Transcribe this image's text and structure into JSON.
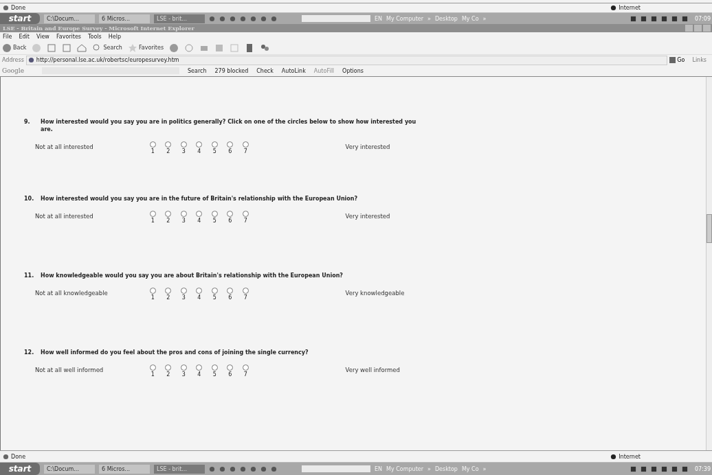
{
  "previous_window": {
    "status": "Done",
    "zone": "Internet"
  },
  "top_taskbar": {
    "start": "start",
    "tasks": [
      {
        "label": "C:\\Docum...",
        "selected": false
      },
      {
        "label": "6 Micros...",
        "selected": false
      },
      {
        "label": "LSE - brit...",
        "selected": true
      }
    ],
    "toolbars": [
      "EN",
      "My Computer",
      "»",
      "Desktop",
      "My Co",
      "»"
    ],
    "clock": "07:09"
  },
  "window": {
    "title": "LSE - Britain and Europe Survey - Microsoft Internet Explorer"
  },
  "menu": [
    "File",
    "Edit",
    "View",
    "Favorites",
    "Tools",
    "Help"
  ],
  "toolbar": {
    "back": "Back",
    "search": "Search",
    "favorites": "Favorites"
  },
  "address": {
    "label": "Address",
    "value": "http://personal.lse.ac.uk/robertsc/europesurvey.htm",
    "go": "Go",
    "links": "Links"
  },
  "google_bar": {
    "logo": "Google",
    "items": [
      "Search",
      "279 blocked",
      "Check",
      "AutoLink",
      "AutoFill",
      "Options"
    ]
  },
  "questions": [
    {
      "number": "9.",
      "text": "How interested would you say you are in politics generally?  Click on one of the circles below to show how interested you are.",
      "low": "Not at all interested",
      "high": "Very interested",
      "options": [
        {
          "label": "1",
          "selected": false
        },
        {
          "label": "2",
          "selected": false
        },
        {
          "label": "3",
          "selected": false
        },
        {
          "label": "4",
          "selected": false
        },
        {
          "label": "5",
          "selected": false
        },
        {
          "label": "6",
          "selected": false
        },
        {
          "label": "7",
          "selected": false
        }
      ]
    },
    {
      "number": "10.",
      "text": "How interested would you say you are in the future of Britain's relationship with the European Union?",
      "low": "Not at all interested",
      "high": "Very interested",
      "options": [
        {
          "label": "1",
          "selected": false
        },
        {
          "label": "2",
          "selected": false
        },
        {
          "label": "3",
          "selected": false
        },
        {
          "label": "4",
          "selected": false
        },
        {
          "label": "5",
          "selected": false
        },
        {
          "label": "6",
          "selected": false
        },
        {
          "label": "7",
          "selected": false
        }
      ]
    },
    {
      "number": "11.",
      "text": "How knowledgeable would you say you are about Britain's relationship with the European Union?",
      "low": "Not at all knowledgeable",
      "high": "Very knowledgeable",
      "options": [
        {
          "label": "1",
          "selected": false
        },
        {
          "label": "2",
          "selected": false
        },
        {
          "label": "3",
          "selected": false
        },
        {
          "label": "4",
          "selected": false
        },
        {
          "label": "5",
          "selected": false
        },
        {
          "label": "6",
          "selected": false
        },
        {
          "label": "7",
          "selected": false
        }
      ]
    },
    {
      "number": "12.",
      "text": "How well informed do you feel about the pros and cons of joining the single currency?",
      "low": "Not at all well informed",
      "high": "Very well informed",
      "options": [
        {
          "label": "1",
          "selected": false
        },
        {
          "label": "2",
          "selected": false
        },
        {
          "label": "3",
          "selected": false
        },
        {
          "label": "4",
          "selected": false
        },
        {
          "label": "5",
          "selected": false
        },
        {
          "label": "6",
          "selected": false
        },
        {
          "label": "7",
          "selected": false
        }
      ]
    }
  ],
  "status_bar": {
    "status": "Done",
    "zone": "Internet"
  },
  "bottom_taskbar": {
    "start": "start",
    "tasks": [
      {
        "label": "C:\\Docum...",
        "selected": false
      },
      {
        "label": "6 Micros...",
        "selected": false
      },
      {
        "label": "LSE - brit...",
        "selected": true
      }
    ],
    "toolbars": [
      "EN",
      "My Computer",
      "»",
      "Desktop",
      "My Co",
      "»"
    ],
    "clock": "07:39"
  }
}
